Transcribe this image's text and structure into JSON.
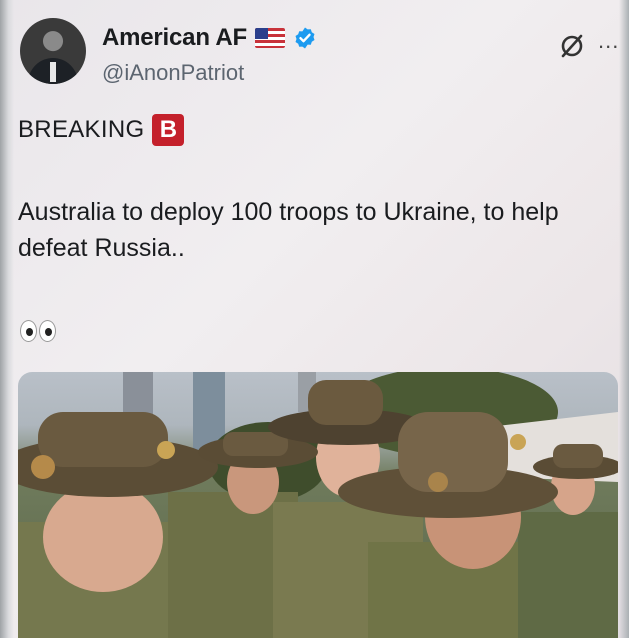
{
  "post": {
    "author": {
      "display_name": "American AF",
      "handle": "@iAnonPatriot",
      "flag_icon": "us-flag-icon",
      "verified_icon": "verified-badge-icon",
      "verified_color": "#1d9bf0"
    },
    "label": "BREAKING",
    "label_badge": "B",
    "label_badge_color": "#c4202b",
    "text": "Australia to deploy 100 troops to Ukraine, to help defeat Russia..",
    "emoji": "eyes-emoji",
    "media": {
      "kind": "photo",
      "description_icon": "photo-icon"
    },
    "actions": {
      "grok_icon": "grok-icon",
      "more_label": "..."
    }
  }
}
